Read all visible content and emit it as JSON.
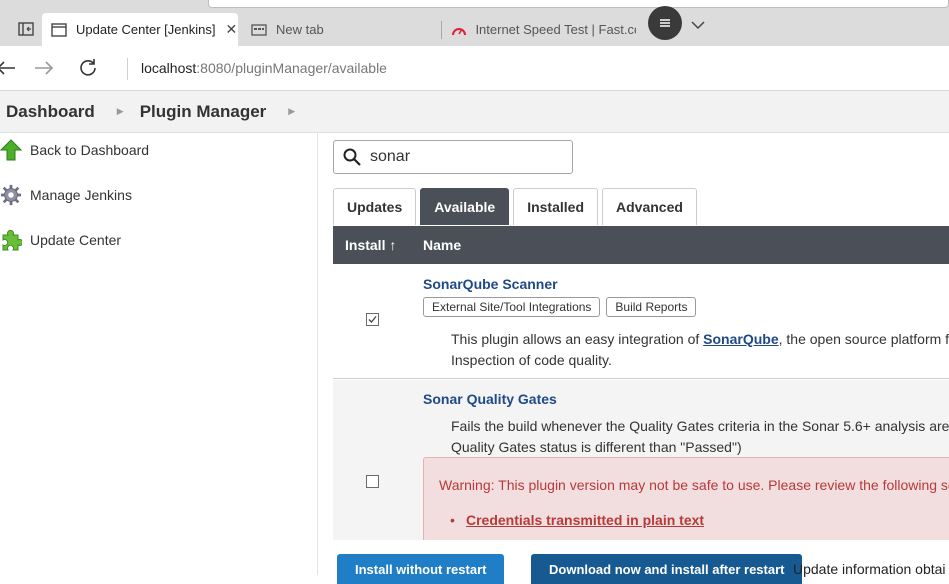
{
  "browser": {
    "tabs": [
      {
        "title": "Update Center [Jenkins]",
        "close": "✕"
      },
      {
        "title": "New tab"
      },
      {
        "title": "Internet Speed Test | Fast.co"
      }
    ],
    "url_host": "localhost",
    "url_rest": ":8080/pluginManager/available"
  },
  "breadcrumbs": {
    "dashboard": "Dashboard",
    "plugin_manager": "Plugin Manager"
  },
  "sidebar": {
    "items": [
      {
        "label": "Back to Dashboard",
        "icon": "green-up-arrow-icon"
      },
      {
        "label": "Manage Jenkins",
        "icon": "gear-icon"
      },
      {
        "label": "Update Center",
        "icon": "puzzle-icon"
      }
    ]
  },
  "search": {
    "value": "sonar"
  },
  "tabs": [
    "Updates",
    "Available",
    "Installed",
    "Advanced"
  ],
  "table": {
    "headers": {
      "install": "Install ↑",
      "name": "Name"
    },
    "rows": [
      {
        "name": "SonarQube Scanner",
        "labels": [
          "External Site/Tool Integrations",
          "Build Reports"
        ],
        "desc_prefix": "This plugin allows an easy integration of ",
        "desc_link": "SonarQube",
        "desc_suffix": ", the open source platform fo",
        "desc_line2": "Inspection of code quality.",
        "checked": true
      },
      {
        "name": "Sonar Quality Gates",
        "desc_line1": "Fails the build whenever the Quality Gates criteria in the Sonar 5.6+ analysis aren'",
        "desc_line2": "Quality Gates status is different than \"Passed\")",
        "warning_text": "Warning: This plugin version may not be safe to use. Please review the following sec",
        "warning_item": "Credentials transmitted in plain text",
        "checked": false
      }
    ]
  },
  "buttons": {
    "install_without_restart": "Install without restart",
    "download_install_after_restart": "Download now and install after restart"
  },
  "update_info": "Update information obtai",
  "colors": {
    "header_dark": "#4b4f58",
    "link": "#204a87",
    "warning_bg": "#f2dede",
    "primary": "#1f7ec6"
  }
}
